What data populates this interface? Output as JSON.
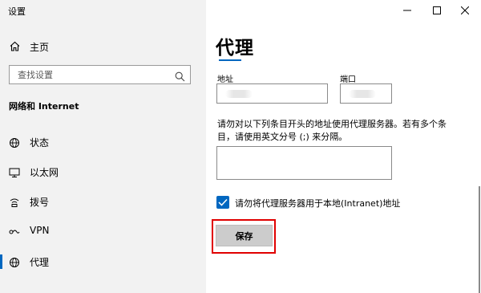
{
  "window": {
    "title": "设置",
    "controls": [
      "minimize-icon",
      "maximize-icon",
      "close-icon"
    ]
  },
  "sidebar": {
    "home_label": "主页",
    "search_placeholder": "查找设置",
    "section_title": "网络和 Internet",
    "items": [
      {
        "label": "状态",
        "icon": "status-globe-icon",
        "active": false
      },
      {
        "label": "以太网",
        "icon": "ethernet-icon",
        "active": false
      },
      {
        "label": "拨号",
        "icon": "dialup-icon",
        "active": false
      },
      {
        "label": "VPN",
        "icon": "vpn-icon",
        "active": false
      },
      {
        "label": "代理",
        "icon": "globe-icon",
        "active": true
      }
    ]
  },
  "main": {
    "title": "代理",
    "address_label": "地址",
    "address_value": "",
    "port_label": "端口",
    "port_value": "",
    "exceptions_description": "请勿对以下列条目开头的地址使用代理服务器。若有多个条目，请使用英文分号 (;) 来分隔。",
    "exceptions_value": "",
    "bypass_local_label": "请勿将代理服务器用于本地(Intranet)地址",
    "bypass_local_checked": true,
    "save_label": "保存"
  },
  "colors": {
    "accent": "#0067c0",
    "sidebar_bg": "#f2f2f2",
    "highlight_border": "#e00000",
    "button_bg": "#cccccc"
  }
}
